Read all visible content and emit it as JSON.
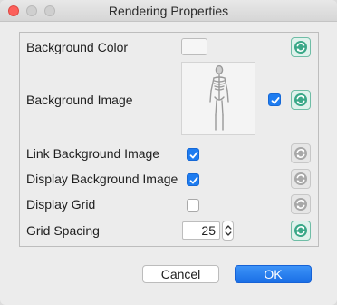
{
  "window": {
    "title": "Rendering Properties"
  },
  "rows": {
    "background_color": {
      "label": "Background Color"
    },
    "background_image": {
      "label": "Background Image",
      "checked": true
    },
    "link_background_image": {
      "label": "Link Background Image",
      "checked": true
    },
    "display_background_image": {
      "label": "Display Background Image",
      "checked": true
    },
    "display_grid": {
      "label": "Display Grid",
      "checked": false
    },
    "grid_spacing": {
      "label": "Grid Spacing",
      "value": "25"
    }
  },
  "buttons": {
    "cancel": "Cancel",
    "ok": "OK"
  },
  "colors": {
    "accent": "#1e7cf0",
    "reset_active": "#3aa888",
    "reset_inactive": "#a8a8a8"
  },
  "icons": {
    "reset": "circular-arrows-reset-icon",
    "checkmark": "checkmark-icon",
    "spinner": "up-down-chevron-icon",
    "thumbnail": "skeleton-image-icon"
  }
}
